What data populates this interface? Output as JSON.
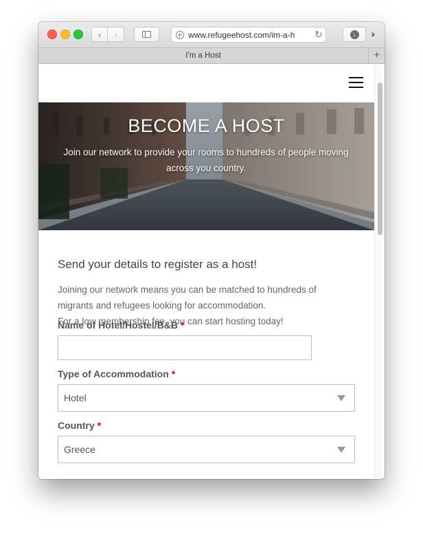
{
  "browser": {
    "url": "www.refugeehost.com/im-a-h",
    "tab_title": "I'm a Host",
    "icons": {
      "back": "chevron-left-icon",
      "forward": "chevron-right-icon",
      "sidebar": "sidebar-icon",
      "reload": "reload-icon",
      "downloads": "download-icon",
      "more": "chevron-double-right-icon",
      "new_tab": "plus-icon",
      "site_info": "plus-circle-icon"
    },
    "glyphs": {
      "back": "‹",
      "forward": "›",
      "reload": "↻",
      "download": "↓",
      "more": "››",
      "new_tab": "+"
    }
  },
  "hero": {
    "title": "BECOME A HOST",
    "subtitle": "Join our network to provide your rooms to hundreds of people moving across you country."
  },
  "form": {
    "heading": "Send your details to register as a host!",
    "intro_lines": [
      "Joining our network means you can be matched to hundreds of",
      "migrants and refugees looking for accommodation.",
      "For a low membership fee, you can start hosting today!"
    ],
    "required_mark": "*",
    "fields": {
      "name": {
        "label": "Name of Hotel/Hostel/B&B",
        "value": ""
      },
      "type": {
        "label": "Type of Accommodation",
        "value": "Hotel"
      },
      "country": {
        "label": "Country",
        "value": "Greece"
      }
    }
  },
  "colors": {
    "required": "#d0021b",
    "text": "#555555",
    "hero_text": "#ffffff"
  }
}
